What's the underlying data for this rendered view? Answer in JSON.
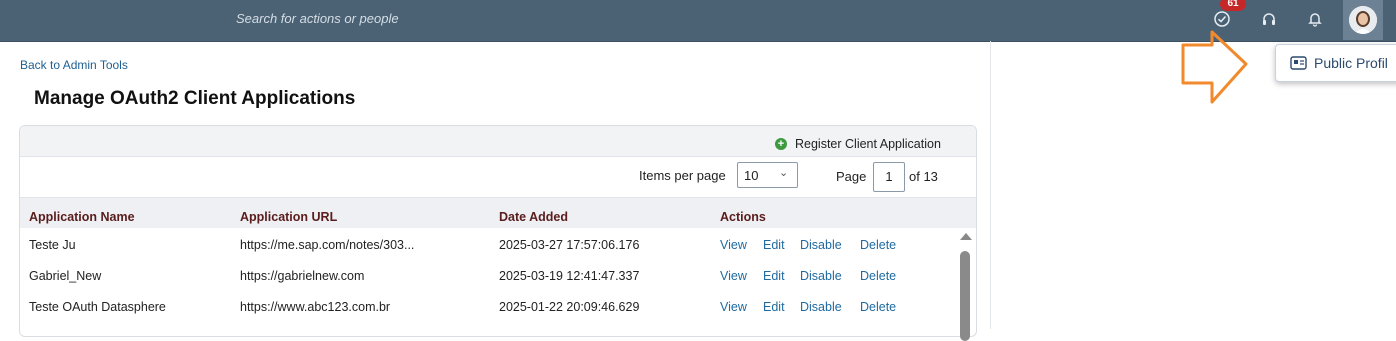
{
  "topbar": {
    "search_placeholder": "Search for actions or people",
    "badge_count": "61",
    "icons": [
      "checkmark-circle-icon",
      "headset-icon",
      "bell-icon",
      "avatar"
    ]
  },
  "user_menu": {
    "public_profile_label": "Public Profil"
  },
  "page": {
    "back_link": "Back to Admin Tools",
    "title": "Manage OAuth2 Client Applications"
  },
  "toolbar": {
    "register_label": "Register Client Application"
  },
  "pagination": {
    "items_per_page_label": "Items per page",
    "items_per_page_value": "10",
    "page_label": "Page",
    "page_value": "1",
    "page_of": "of 13"
  },
  "table": {
    "columns": [
      "Application Name",
      "Application URL",
      "Date Added",
      "Actions"
    ],
    "rows": [
      {
        "name": "Teste Ju",
        "url": "https://me.sap.com/notes/303...",
        "date": "2025-03-27 17:57:06.176"
      },
      {
        "name": "Gabriel_New",
        "url": "https://gabrielnew.com",
        "date": "2025-03-19 12:41:47.337"
      },
      {
        "name": "Teste OAuth Datasphere",
        "url": "https://www.abc123.com.br",
        "date": "2025-01-22 20:09:46.629"
      }
    ],
    "actions": [
      "View",
      "Edit",
      "Disable",
      "Delete"
    ]
  },
  "colors": {
    "topbar": "#4b6275",
    "link": "#1f6aa0",
    "header_text": "#5a1c1c",
    "arrow": "#f08a2c",
    "badge": "#c62828"
  }
}
